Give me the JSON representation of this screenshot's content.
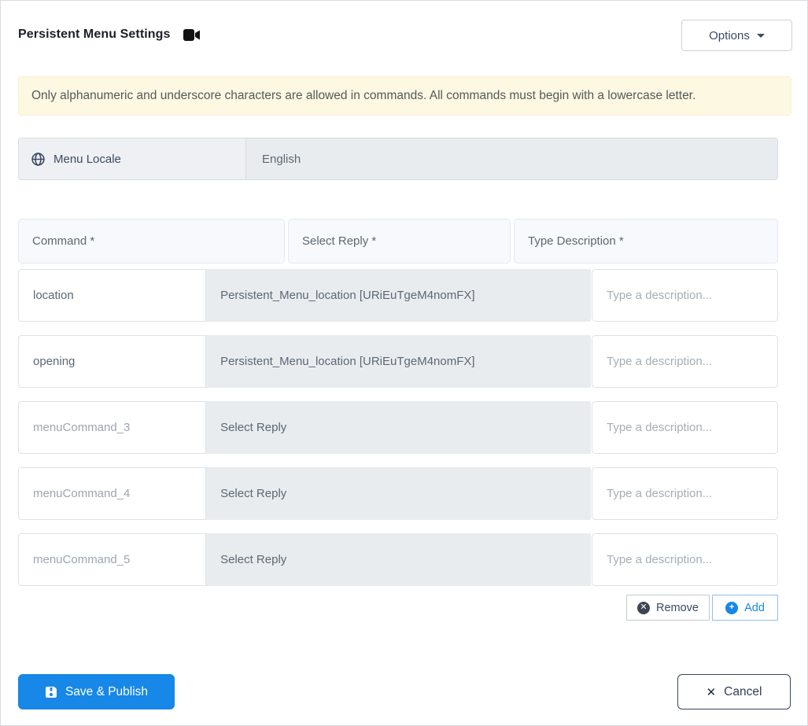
{
  "header": {
    "title": "Persistent Menu Settings",
    "options_label": "Options"
  },
  "alert": {
    "text": "Only alphanumeric and underscore characters are allowed in commands. All commands must begin with a lowercase letter."
  },
  "locale": {
    "label": "Menu Locale",
    "value": "English"
  },
  "table": {
    "headers": {
      "command": "Command *",
      "reply": "Select Reply *",
      "description": "Type Description *"
    },
    "rows": [
      {
        "command_value": "location",
        "command_placeholder": "",
        "reply": "Persistent_Menu_location [URiEuTgeM4nomFX]",
        "description_value": "",
        "description_placeholder": "Type a description..."
      },
      {
        "command_value": "opening",
        "command_placeholder": "",
        "reply": "Persistent_Menu_location [URiEuTgeM4nomFX]",
        "description_value": "",
        "description_placeholder": "Type a description..."
      },
      {
        "command_value": "",
        "command_placeholder": "menuCommand_3",
        "reply": "Select Reply",
        "description_value": "",
        "description_placeholder": "Type a description..."
      },
      {
        "command_value": "",
        "command_placeholder": "menuCommand_4",
        "reply": "Select Reply",
        "description_value": "",
        "description_placeholder": "Type a description..."
      },
      {
        "command_value": "",
        "command_placeholder": "menuCommand_5",
        "reply": "Select Reply",
        "description_value": "",
        "description_placeholder": "Type a description..."
      }
    ]
  },
  "actions": {
    "remove_label": "Remove",
    "add_label": "Add",
    "remove_icon_glyph": "✕",
    "add_icon_glyph": "+"
  },
  "footer": {
    "save_label": "Save & Publish",
    "cancel_label": "Cancel",
    "cancel_icon_glyph": "✕"
  },
  "colors": {
    "primary_blue": "#1787e8",
    "alert_bg": "#fdf8e2",
    "disabled_gray": "#e9ecef",
    "header_cell_bg": "#f7f9fc",
    "dark_slate_text": "#3c4b64",
    "body_text": "#5c6873",
    "placeholder_text": "#9da5b1"
  }
}
